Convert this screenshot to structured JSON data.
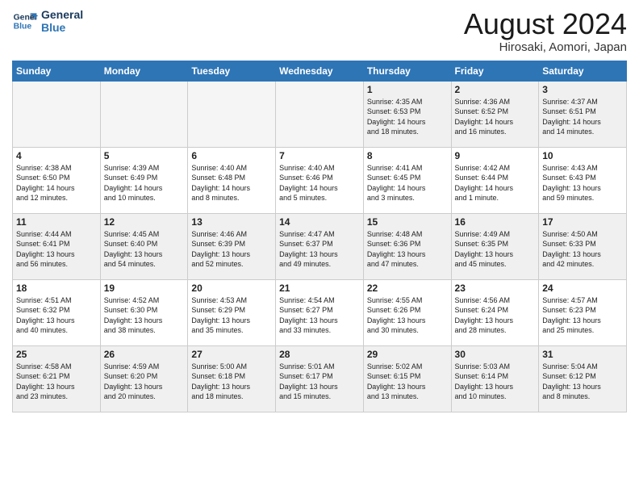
{
  "logo": {
    "line1": "General",
    "line2": "Blue"
  },
  "title": "August 2024",
  "location": "Hirosaki, Aomori, Japan",
  "days_of_week": [
    "Sunday",
    "Monday",
    "Tuesday",
    "Wednesday",
    "Thursday",
    "Friday",
    "Saturday"
  ],
  "weeks": [
    [
      {
        "num": "",
        "info": ""
      },
      {
        "num": "",
        "info": ""
      },
      {
        "num": "",
        "info": ""
      },
      {
        "num": "",
        "info": ""
      },
      {
        "num": "1",
        "info": "Sunrise: 4:35 AM\nSunset: 6:53 PM\nDaylight: 14 hours\nand 18 minutes."
      },
      {
        "num": "2",
        "info": "Sunrise: 4:36 AM\nSunset: 6:52 PM\nDaylight: 14 hours\nand 16 minutes."
      },
      {
        "num": "3",
        "info": "Sunrise: 4:37 AM\nSunset: 6:51 PM\nDaylight: 14 hours\nand 14 minutes."
      }
    ],
    [
      {
        "num": "4",
        "info": "Sunrise: 4:38 AM\nSunset: 6:50 PM\nDaylight: 14 hours\nand 12 minutes."
      },
      {
        "num": "5",
        "info": "Sunrise: 4:39 AM\nSunset: 6:49 PM\nDaylight: 14 hours\nand 10 minutes."
      },
      {
        "num": "6",
        "info": "Sunrise: 4:40 AM\nSunset: 6:48 PM\nDaylight: 14 hours\nand 8 minutes."
      },
      {
        "num": "7",
        "info": "Sunrise: 4:40 AM\nSunset: 6:46 PM\nDaylight: 14 hours\nand 5 minutes."
      },
      {
        "num": "8",
        "info": "Sunrise: 4:41 AM\nSunset: 6:45 PM\nDaylight: 14 hours\nand 3 minutes."
      },
      {
        "num": "9",
        "info": "Sunrise: 4:42 AM\nSunset: 6:44 PM\nDaylight: 14 hours\nand 1 minute."
      },
      {
        "num": "10",
        "info": "Sunrise: 4:43 AM\nSunset: 6:43 PM\nDaylight: 13 hours\nand 59 minutes."
      }
    ],
    [
      {
        "num": "11",
        "info": "Sunrise: 4:44 AM\nSunset: 6:41 PM\nDaylight: 13 hours\nand 56 minutes."
      },
      {
        "num": "12",
        "info": "Sunrise: 4:45 AM\nSunset: 6:40 PM\nDaylight: 13 hours\nand 54 minutes."
      },
      {
        "num": "13",
        "info": "Sunrise: 4:46 AM\nSunset: 6:39 PM\nDaylight: 13 hours\nand 52 minutes."
      },
      {
        "num": "14",
        "info": "Sunrise: 4:47 AM\nSunset: 6:37 PM\nDaylight: 13 hours\nand 49 minutes."
      },
      {
        "num": "15",
        "info": "Sunrise: 4:48 AM\nSunset: 6:36 PM\nDaylight: 13 hours\nand 47 minutes."
      },
      {
        "num": "16",
        "info": "Sunrise: 4:49 AM\nSunset: 6:35 PM\nDaylight: 13 hours\nand 45 minutes."
      },
      {
        "num": "17",
        "info": "Sunrise: 4:50 AM\nSunset: 6:33 PM\nDaylight: 13 hours\nand 42 minutes."
      }
    ],
    [
      {
        "num": "18",
        "info": "Sunrise: 4:51 AM\nSunset: 6:32 PM\nDaylight: 13 hours\nand 40 minutes."
      },
      {
        "num": "19",
        "info": "Sunrise: 4:52 AM\nSunset: 6:30 PM\nDaylight: 13 hours\nand 38 minutes."
      },
      {
        "num": "20",
        "info": "Sunrise: 4:53 AM\nSunset: 6:29 PM\nDaylight: 13 hours\nand 35 minutes."
      },
      {
        "num": "21",
        "info": "Sunrise: 4:54 AM\nSunset: 6:27 PM\nDaylight: 13 hours\nand 33 minutes."
      },
      {
        "num": "22",
        "info": "Sunrise: 4:55 AM\nSunset: 6:26 PM\nDaylight: 13 hours\nand 30 minutes."
      },
      {
        "num": "23",
        "info": "Sunrise: 4:56 AM\nSunset: 6:24 PM\nDaylight: 13 hours\nand 28 minutes."
      },
      {
        "num": "24",
        "info": "Sunrise: 4:57 AM\nSunset: 6:23 PM\nDaylight: 13 hours\nand 25 minutes."
      }
    ],
    [
      {
        "num": "25",
        "info": "Sunrise: 4:58 AM\nSunset: 6:21 PM\nDaylight: 13 hours\nand 23 minutes."
      },
      {
        "num": "26",
        "info": "Sunrise: 4:59 AM\nSunset: 6:20 PM\nDaylight: 13 hours\nand 20 minutes."
      },
      {
        "num": "27",
        "info": "Sunrise: 5:00 AM\nSunset: 6:18 PM\nDaylight: 13 hours\nand 18 minutes."
      },
      {
        "num": "28",
        "info": "Sunrise: 5:01 AM\nSunset: 6:17 PM\nDaylight: 13 hours\nand 15 minutes."
      },
      {
        "num": "29",
        "info": "Sunrise: 5:02 AM\nSunset: 6:15 PM\nDaylight: 13 hours\nand 13 minutes."
      },
      {
        "num": "30",
        "info": "Sunrise: 5:03 AM\nSunset: 6:14 PM\nDaylight: 13 hours\nand 10 minutes."
      },
      {
        "num": "31",
        "info": "Sunrise: 5:04 AM\nSunset: 6:12 PM\nDaylight: 13 hours\nand 8 minutes."
      }
    ]
  ],
  "shaded_rows": [
    0,
    2,
    4
  ]
}
